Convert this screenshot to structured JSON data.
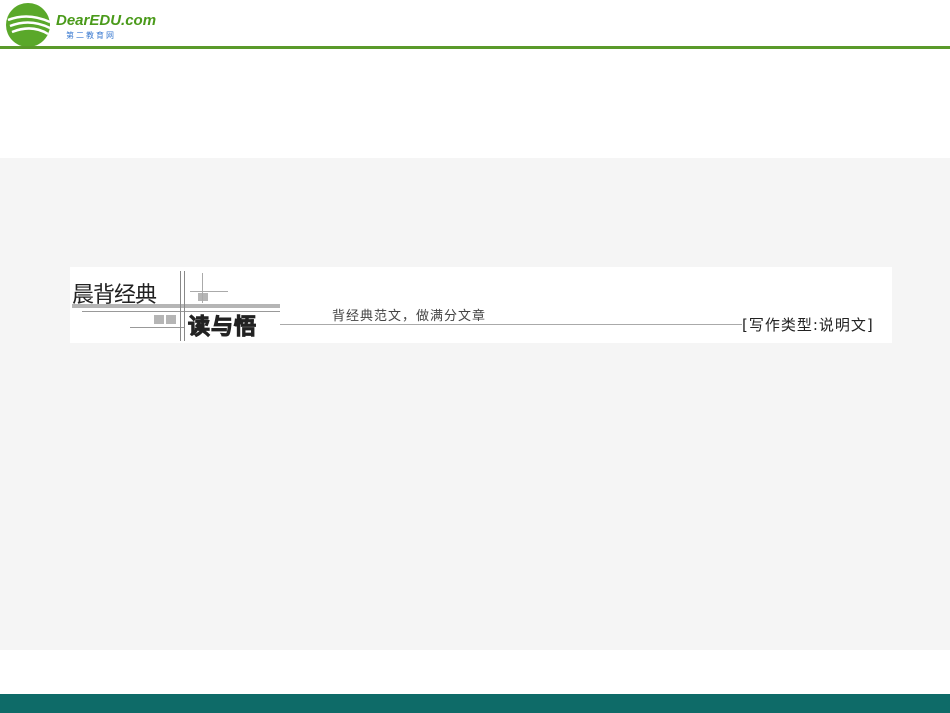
{
  "logo": {
    "brand": "DearEDU.com",
    "subtitle": "第二教育网"
  },
  "banner": {
    "title_top": "晨背经典",
    "title_bottom": "读与悟",
    "subtitle": "背经典范文，做满分文章",
    "writing_type": "[写作类型:说明文]"
  },
  "colors": {
    "header_line": "#5a9a2a",
    "footer": "#0e6b68",
    "stage": "#f5f5f5"
  }
}
